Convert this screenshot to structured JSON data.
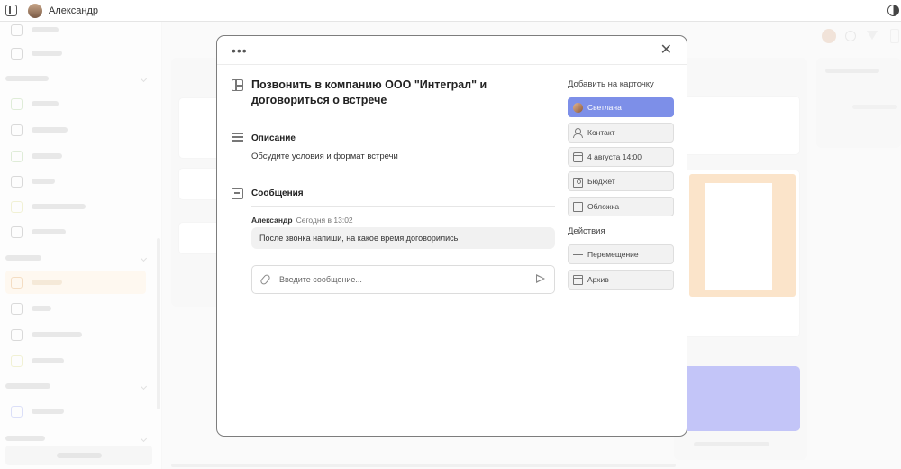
{
  "topbar": {
    "user_name": "Александр"
  },
  "modal": {
    "title": "Позвонить в компанию ООО \"Интеграл\" и договориться о встрече",
    "description_heading": "Описание",
    "description_text": "Обсудите условия и формат встречи",
    "messages_heading": "Сообщения",
    "messages": [
      {
        "author": "Александр",
        "time": "Сегодня в 13:02",
        "text": "После звонка напиши, на какое время договорились"
      }
    ],
    "message_input": {
      "placeholder": "Введите сообщение...",
      "value": ""
    },
    "add_to_card_heading": "Добавить на карточку",
    "add_buttons": [
      {
        "label": "Светлана",
        "icon": "user-avatar"
      },
      {
        "label": "Контакт",
        "icon": "person-icon"
      },
      {
        "label": "4 августа 14:00",
        "icon": "calendar-icon"
      },
      {
        "label": "Бюджет",
        "icon": "money-icon"
      },
      {
        "label": "Обложка",
        "icon": "image-icon"
      }
    ],
    "actions_heading": "Действия",
    "action_buttons": [
      {
        "label": "Перемещение",
        "icon": "move-icon"
      },
      {
        "label": "Архив",
        "icon": "archive-icon"
      }
    ]
  },
  "colors": {
    "accent": "#7d8fe8",
    "active_sidebar": "#fdf0dd",
    "orange_card": "#f6c48a",
    "purple_card": "#7b7ff0"
  }
}
